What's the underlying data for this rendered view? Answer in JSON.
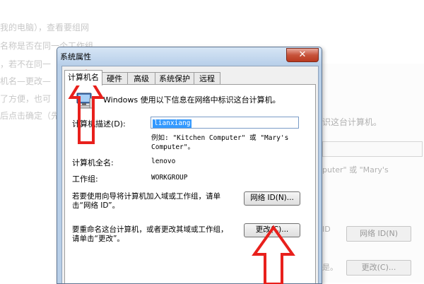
{
  "background": {
    "left_lines": [
      "我的电脑），查看要组网",
      "名称是否在同一个工作组",
      "，若不在同一",
      "机名—更改—",
      "了方便，也可",
      "后点击确定（先"
    ],
    "right_lines": [
      "识这台计算机。",
      "puter\" 或 \"Mary's"
    ],
    "right_buttons": [
      "网络 ID(N)",
      "更改(C)..."
    ],
    "right_partial_labels": [
      "ID",
      "是。"
    ]
  },
  "dialog": {
    "title": "系统属性",
    "close_glyph": "✕",
    "tabs": [
      "计算机名",
      "硬件",
      "高级",
      "系统保护",
      "远程"
    ],
    "active_tab_index": 0,
    "intro": "Windows 使用以下信息在网络中标识这台计算机。",
    "description_label": "计算机描述(D):",
    "description_value": "lianxiang",
    "example_line1": "例如: \"Kitchen Computer\" 或 \"Mary's",
    "example_line2": "Computer\"。",
    "full_name_label": "计算机全名:",
    "full_name_value": "lenovo",
    "workgroup_label": "工作组:",
    "workgroup_value": "WORKGROUP",
    "network_id_text_1": "若要使用向导将计算机加入域或工作组，请单",
    "network_id_text_2": "击“网络 ID”。",
    "network_id_button": "网络 ID(N)...",
    "rename_text_1": "要重命名这台计算机，或者更改其域或工作组，",
    "rename_text_2": "请单击“更改”。",
    "change_button": "更改(C)..."
  },
  "colors": {
    "arrow": "#e8201c",
    "frame": "#b8cfe8",
    "close": "#c7533b",
    "selection": "#3399ff"
  }
}
